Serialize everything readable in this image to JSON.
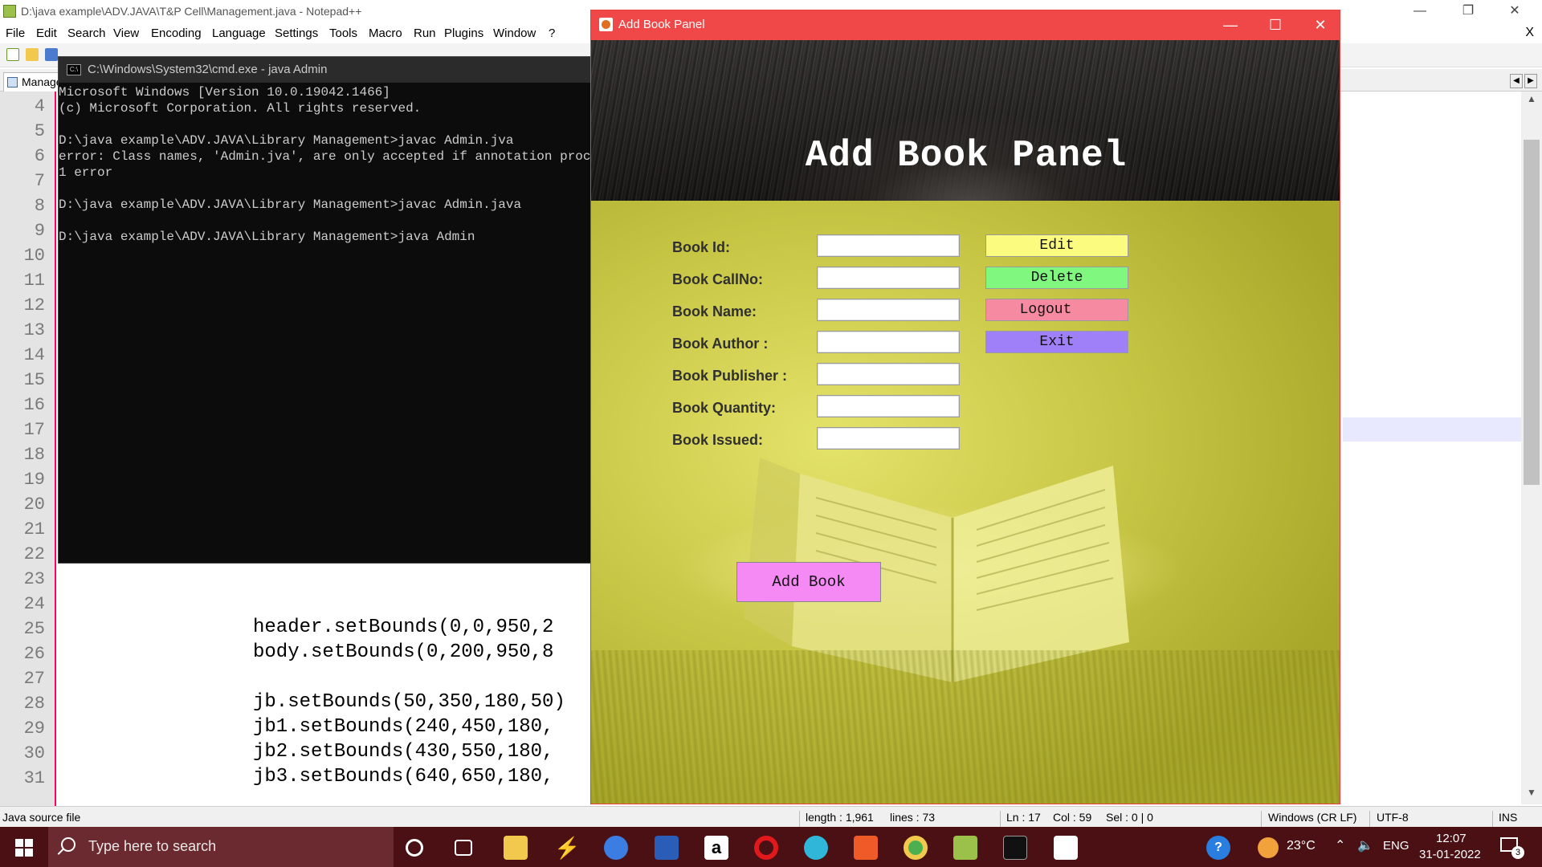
{
  "npp": {
    "title": "D:\\java example\\ADV.JAVA\\T&P Cell\\Management.java - Notepad++",
    "menu": [
      "File",
      "Edit",
      "Search",
      "View",
      "Encoding",
      "Language",
      "Settings",
      "Tools",
      "Macro",
      "Run",
      "Plugins",
      "Window",
      "?"
    ],
    "menu_close": "X",
    "tab_label": "Management.java",
    "line_numbers": [
      "4",
      "5",
      "6",
      "7",
      "8",
      "9",
      "10",
      "11",
      "12",
      "13",
      "14",
      "15",
      "16",
      "17",
      "18",
      "19",
      "20",
      "21",
      "22",
      "23",
      "24",
      "25",
      "26",
      "27",
      "28",
      "29",
      "30",
      "31"
    ],
    "code_lines": [
      {
        "text": "header.setBounds(0,0,950,2"
      },
      {
        "text": "body.setBounds(0,200,950,8"
      },
      {
        "text": "jb.setBounds(50,350,180,50)"
      },
      {
        "text": "jb1.setBounds(240,450,180,"
      },
      {
        "text": "jb2.setBounds(430,550,180,"
      },
      {
        "text": "jb3.setBounds(640,650,180,"
      }
    ],
    "status": {
      "file_type": "Java source file",
      "length": "length : 1,961",
      "lines": "lines : 73",
      "ln": "Ln : 17",
      "col": "Col : 59",
      "sel": "Sel : 0 | 0",
      "eol": "Windows (CR LF)",
      "encoding": "UTF-8",
      "mode": "INS"
    }
  },
  "cmd": {
    "title": "C:\\Windows\\System32\\cmd.exe - java  Admin",
    "lines": [
      "Microsoft Windows [Version 10.0.19042.1466]",
      "(c) Microsoft Corporation. All rights reserved.",
      "",
      "D:\\java example\\ADV.JAVA\\Library Management>javac Admin.jva",
      "error: Class names, 'Admin.jva', are only accepted if annotation processin",
      "1 error",
      "",
      "D:\\java example\\ADV.JAVA\\Library Management>javac Admin.java",
      "",
      "D:\\java example\\ADV.JAVA\\Library Management>java Admin"
    ]
  },
  "panel": {
    "window_title": "Add Book Panel",
    "heading": "Add Book Panel",
    "labels": {
      "book_id": "Book Id:",
      "callno": "Book CallNo:",
      "name": "Book Name:",
      "author": "Book Author :",
      "publisher": "Book Publisher :",
      "quantity": "Book Quantity:",
      "issued": "Book Issued:"
    },
    "fields": {
      "book_id": "",
      "callno": "",
      "name": "",
      "author": "",
      "publisher": "",
      "quantity": "",
      "issued": ""
    },
    "buttons": {
      "edit": "Edit",
      "delete": "Delete",
      "logout": "Logout",
      "exit": "Exit",
      "add_book": "Add Book"
    },
    "button_colors": {
      "edit": "#fbfb80",
      "delete": "#80f880",
      "logout": "#f58aa0",
      "exit": "#a080f8",
      "add_book": "#f58af5"
    }
  },
  "taskbar": {
    "search_placeholder": "Type here to search",
    "temperature": "23°C",
    "language": "ENG",
    "time": "12:07",
    "date": "31-01-2022",
    "notification_count": "3"
  }
}
